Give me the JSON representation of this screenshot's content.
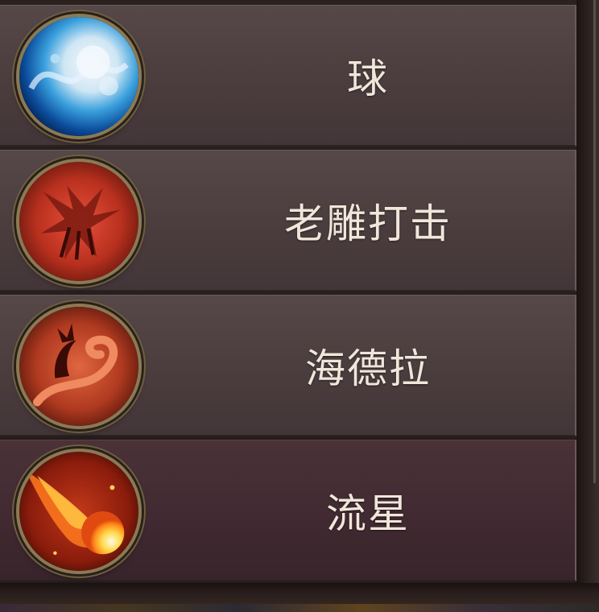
{
  "spells": [
    {
      "label": "球",
      "icon": "water-orb-icon"
    },
    {
      "label": "老雕打击",
      "icon": "eagle-strike-icon"
    },
    {
      "label": "海德拉",
      "icon": "hydra-icon"
    },
    {
      "label": "流星",
      "icon": "meteor-icon"
    }
  ],
  "colors": {
    "row_bg": "#4b3d3e",
    "row_selected_bg": "#412a31",
    "label_text": "#f0e6da",
    "icon_frame": "#8a7a55"
  }
}
